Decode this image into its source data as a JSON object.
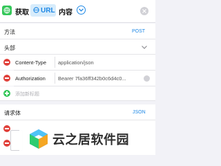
{
  "action": {
    "verb": "获取",
    "url_label": "URL",
    "noun": "内容"
  },
  "method": {
    "label": "方法",
    "value": "POST"
  },
  "headers": {
    "section_label": "头部",
    "items": [
      {
        "key": "Content-Type",
        "value": "application/json"
      },
      {
        "key": "Authorization",
        "value": "Bearer 7fa36ff342b0c6d4c0..."
      }
    ],
    "add_label": "添加新标题"
  },
  "body": {
    "label": "请求体",
    "value": "JSON"
  },
  "watermark": {
    "text": "云之居软件园"
  },
  "colors": {
    "accent": "#1e88e5",
    "add": "#34c759",
    "remove": "#e0403a",
    "background": "#f2f2f7"
  },
  "icons": {
    "action": "globe-download-icon",
    "expand": "chevron-down-icon",
    "close": "close-icon"
  }
}
